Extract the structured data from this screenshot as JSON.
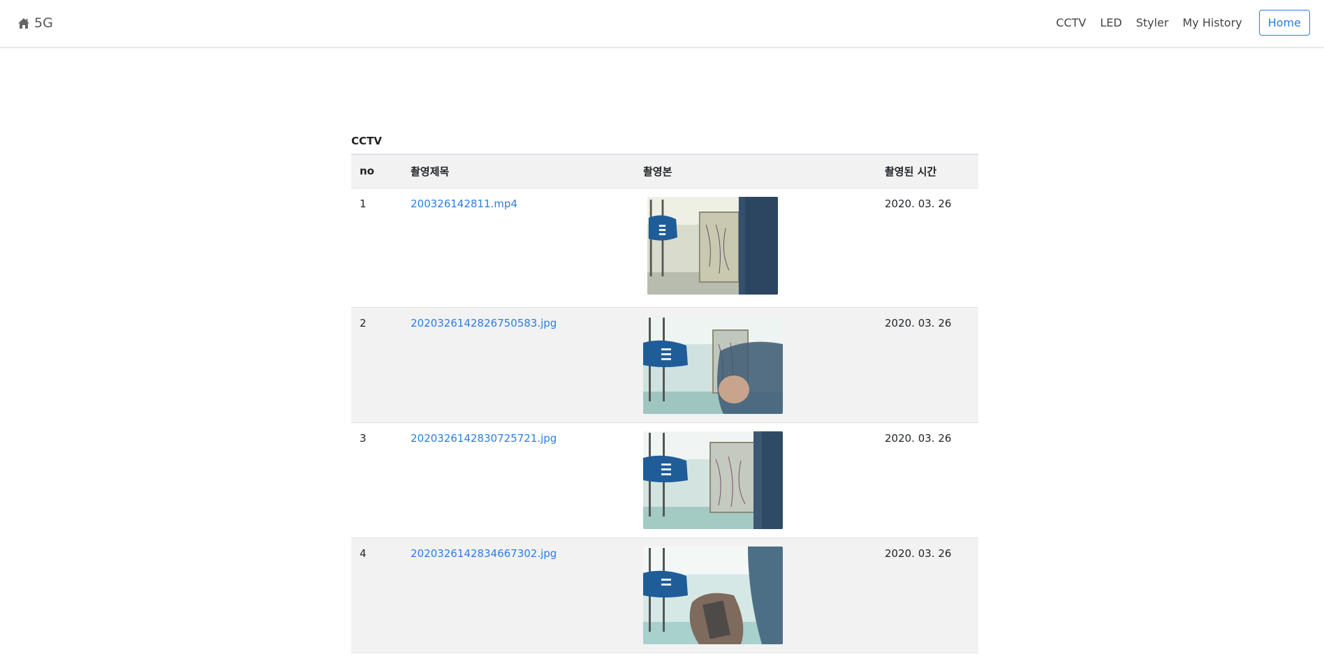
{
  "nav": {
    "brand": "5G",
    "links": [
      "CCTV",
      "LED",
      "Styler",
      "My History"
    ],
    "home": "Home"
  },
  "table": {
    "caption": "CCTV",
    "headers": [
      "no",
      "촬영제목",
      "촬영본",
      "촬영된 시간"
    ],
    "rows": [
      {
        "no": "1",
        "title": "200326142811.mp4",
        "time": "2020. 03. 26"
      },
      {
        "no": "2",
        "title": "2020326142826750583.jpg",
        "time": "2020. 03. 26"
      },
      {
        "no": "3",
        "title": "2020326142830725721.jpg",
        "time": "2020. 03. 26"
      },
      {
        "no": "4",
        "title": "2020326142834667302.jpg",
        "time": "2020. 03. 26"
      }
    ]
  },
  "colors": {
    "accent": "#2b7de0",
    "row_alt": "#f2f2f2",
    "chair": "#1f5d99"
  },
  "icons": {
    "brand": "home-icon"
  }
}
